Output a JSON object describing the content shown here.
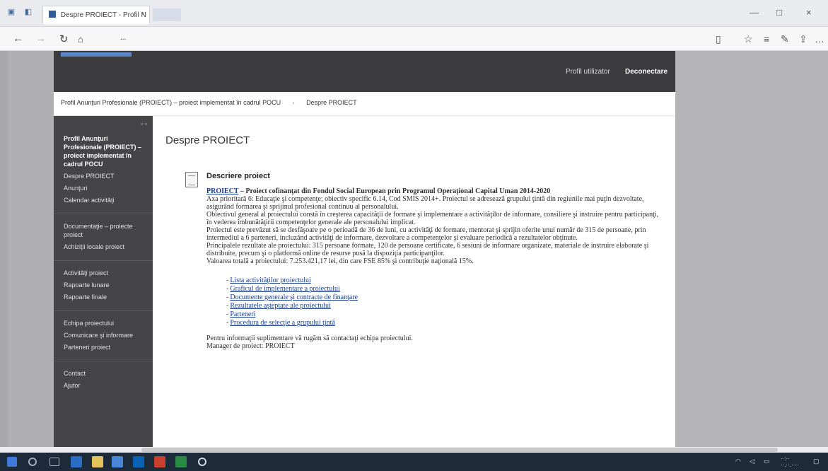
{
  "browser": {
    "tab_title": "Despre PROIECT - Profil N",
    "tab_close": "×",
    "url_host": "...",
    "url_rest": "",
    "win_min": "—",
    "win_max": "□",
    "win_close": "×"
  },
  "header": {
    "link1": "Profil utilizator",
    "link2": "Deconectare"
  },
  "breadcrumb": {
    "item1": "Profil Anunţuri Profesionale (PROIECT) – proiect implementat în cadrul POCU",
    "item2": "Despre PROIECT"
  },
  "sidebar": {
    "groups": [
      [
        "Profil Anunţuri Profesionale (PROIECT) – proiect implementat în cadrul POCU",
        "Despre PROIECT",
        "Anunţuri",
        "Calendar activităţi"
      ],
      [
        "Documentaţie – proiecte proiect",
        "Achiziţii locale proiect"
      ],
      [
        "Activităţi proiect",
        "Rapoarte lunare",
        "Rapoarte finale"
      ],
      [
        "Echipa proiectului",
        "Comunicare şi informare",
        "Parteneri proiect"
      ],
      [
        "Contact",
        "Ajutor"
      ]
    ]
  },
  "main": {
    "title": "Despre PROIECT",
    "doc_title": "Descriere proiect",
    "lead_link": "PROIECT",
    "lead_text": " – Proiect cofinanţat din Fondul Social European prin Programul Operaţional Capital Uman 2014-2020",
    "paragraphs": [
      "Axa prioritară 6: Educaţie şi competenţe; obiectiv specific 6.14, Cod SMIS 2014+. Proiectul se adresează grupului ţintă din regiunile mai puţin dezvoltate, asigurând formarea şi sprijinul profesional continuu al personalului.",
      "Obiectivul general al proiectului constă în creşterea capacităţii de formare şi implementare a activităţilor de informare, consiliere şi instruire pentru participanţi, în vederea îmbunătăţirii competenţelor generale ale personalului implicat.",
      "Proiectul este prevăzut să se desfăşoare pe o perioadă de 36 de luni, cu activităţi de formare, mentorat şi sprijin oferite unui număr de 315 de persoane, prin intermediul a 6 parteneri, incluzând activităţi de informare, dezvoltare a competenţelor şi evaluare periodică a rezultatelor obţinute.",
      "Principalele rezultate ale proiectului: 315 persoane formate, 120 de persoane certificate, 6 sesiuni de informare organizate, materiale de instruire elaborate şi distribuite, precum şi o platformă online de resurse pusă la dispoziţia participanţilor."
    ],
    "closing_line": "Valoarea totală a proiectului: 7.253.421,17 lei, din care FSE 85% şi contribuţie naţională 15%.",
    "links": [
      "Lista activităţilor proiectului",
      "Graficul de implementare a proiectului",
      "Documente generale şi contracte de finanţare",
      "Rezultatele aşteptate ale proiectului",
      "Parteneri",
      "Procedura de selecţie a grupului ţintă"
    ],
    "footer1": "Pentru informaţii suplimentare vă rugăm să contactaţi echipa proiectului.",
    "footer2": "Manager de proiect: PROIECT"
  }
}
